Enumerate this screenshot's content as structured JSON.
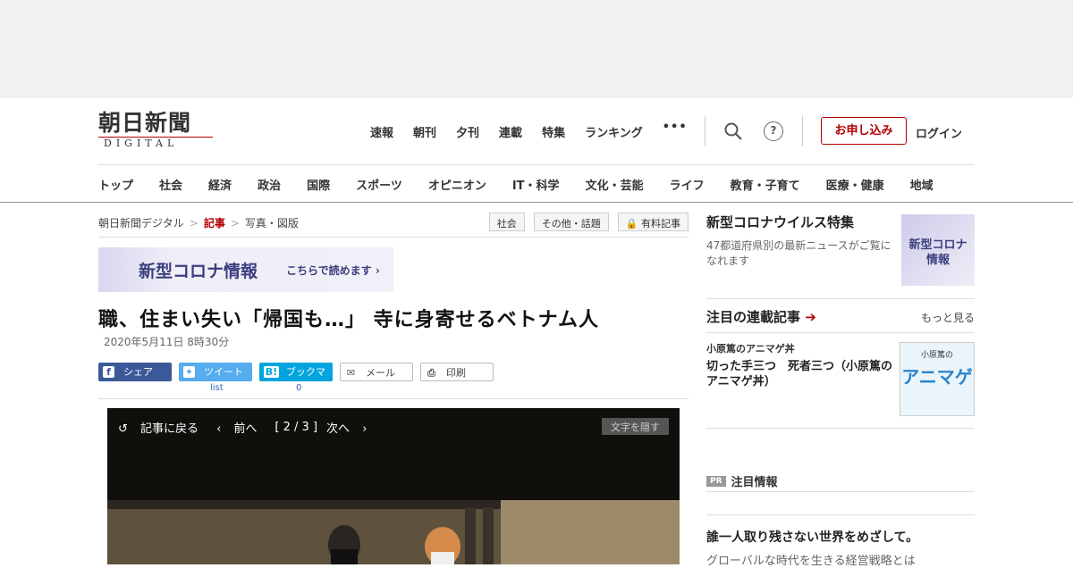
{
  "logo": {
    "jp": "朝日新聞",
    "en": "DIGITAL"
  },
  "topnav": [
    "速報",
    "朝刊",
    "夕刊",
    "連載",
    "特集",
    "ランキング"
  ],
  "more_dots": "•••",
  "help": "?",
  "subscribe": "お申し込み",
  "login": "ログイン",
  "categories": [
    "トップ",
    "社会",
    "経済",
    "政治",
    "国際",
    "スポーツ",
    "オピニオン",
    "IT・科学",
    "文化・芸能",
    "ライフ",
    "教育・子育て",
    "医療・健康",
    "地域"
  ],
  "breadcrumb": {
    "home": "朝日新聞デジタル",
    "section": "記事",
    "current": "写真・図版",
    "sep": ">"
  },
  "tags": [
    "社会",
    "その他・話題",
    "有料記事"
  ],
  "banner": {
    "title": "新型コロナ情報",
    "link": "こちらで読めます"
  },
  "article": {
    "headline": "職、住まい失い「帰国も…」 寺に身寄せるベトナム人",
    "date": "2020年5月11日 8時30分"
  },
  "share": {
    "facebook": "シェア",
    "twitter": "ツイート",
    "hatena": "ブックマーク",
    "mail": "メール",
    "print": "印刷",
    "twitter_count": "list",
    "hatena_count": "0"
  },
  "photo": {
    "back": "記事に戻る",
    "prev": "前へ",
    "page": "[ 2 / 3 ]",
    "next": "次へ",
    "hide": "文字を隠す"
  },
  "side": {
    "corona_title": "新型コロナウイルス特集",
    "corona_desc": "47都道府県別の最新ニュースがご覧になれます",
    "corona_thumb": [
      "新型コロナ",
      "情報"
    ],
    "series_title": "注目の連載記事",
    "series_more": "もっと見る",
    "item_cat": "小原篤のアニマゲ丼",
    "item_title": "切った手三つ　死者三つ（小原篤のアニマゲ丼）",
    "item_thumb_label": "小原篤の",
    "item_thumb_big": "アニマゲ",
    "pr_badge": "PR",
    "pr_label": "注目情報",
    "promo_title": "誰一人取り残さない世界をめざして。",
    "promo_sub": "グローバルな時代を生きる経営戦略とは"
  },
  "colors": {
    "brand_red": "#b30000",
    "facebook": "#3b5998",
    "twitter": "#55acee",
    "hatena": "#00a4de"
  }
}
